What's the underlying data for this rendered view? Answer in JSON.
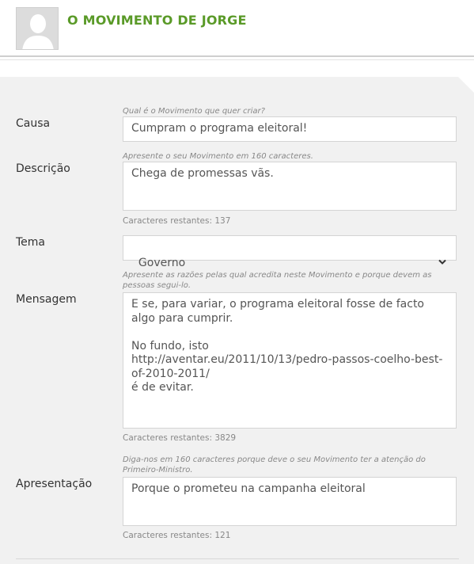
{
  "header": {
    "title": "O MOVIMENTO DE JORGE"
  },
  "form": {
    "causa": {
      "label": "Causa",
      "hint": "Qual é o Movimento que quer criar?",
      "value": "Cumpram o programa eleitoral!"
    },
    "descricao": {
      "label": "Descrição",
      "hint": "Apresente o seu Movimento em 160 caracteres.",
      "value": "Chega de promessas vãs.",
      "counter": "Caracteres restantes: 137"
    },
    "tema": {
      "label": "Tema",
      "value": "Governo"
    },
    "mensagem": {
      "label": "Mensagem",
      "hint": "Apresente as razões pelas qual acredita neste Movimento e porque devem as pessoas segui-lo.",
      "value": "E se, para variar, o programa eleitoral fosse de facto algo para cumprir.\n\nNo fundo, isto\nhttp://aventar.eu/2011/10/13/pedro-passos-coelho-best-of-2010-2011/\né de evitar.",
      "counter": "Caracteres restantes: 3829"
    },
    "apresentacao": {
      "label": "Apresentação",
      "hint": "Diga-nos em 160 caracteres porque deve o seu Movimento ter a atenção do Primeiro-Ministro.",
      "value": "Porque o prometeu na campanha eleitoral",
      "counter": "Caracteres restantes: 121"
    }
  },
  "colors": {
    "title_green": "#5a9a28",
    "panel_bg": "#f1f1f1"
  },
  "icons": {
    "avatar": "default-user-avatar",
    "select": "chevron-down-icon"
  }
}
